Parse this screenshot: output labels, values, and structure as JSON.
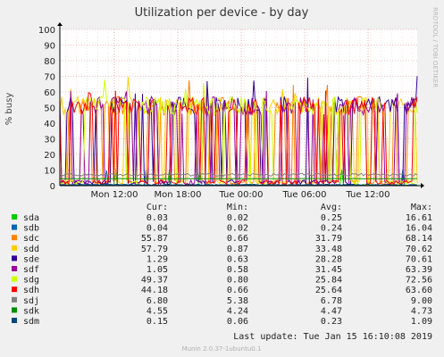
{
  "chart_data": {
    "type": "line",
    "title": "Utilization per device - by day",
    "ylabel": "% busy",
    "ylim": [
      0,
      100
    ],
    "y_ticks": [
      0,
      10,
      20,
      30,
      40,
      50,
      60,
      70,
      80,
      90,
      100
    ],
    "x_ticks": [
      "Mon 12:00",
      "Mon 18:00",
      "Tue 00:00",
      "Tue 06:00",
      "Tue 12:00"
    ],
    "grid": true,
    "watermark": "RRDTOOL / TOBI OETIKER",
    "legend_headers": {
      "cur": "Cur:",
      "min": "Min:",
      "avg": "Avg:",
      "max": "Max:"
    },
    "series": [
      {
        "name": "sda",
        "color": "#00cc00",
        "cur": "0.03",
        "min": "0.02",
        "avg": "0.25",
        "max": "16.61"
      },
      {
        "name": "sdb",
        "color": "#0066b3",
        "cur": "0.04",
        "min": "0.02",
        "avg": "0.24",
        "max": "16.04"
      },
      {
        "name": "sdc",
        "color": "#ff8000",
        "cur": "55.87",
        "min": "0.66",
        "avg": "31.79",
        "max": "68.14"
      },
      {
        "name": "sdd",
        "color": "#ffcc00",
        "cur": "57.79",
        "min": "0.87",
        "avg": "33.48",
        "max": "70.62"
      },
      {
        "name": "sde",
        "color": "#330099",
        "cur": "1.29",
        "min": "0.63",
        "avg": "28.28",
        "max": "70.61"
      },
      {
        "name": "sdf",
        "color": "#990099",
        "cur": "1.05",
        "min": "0.58",
        "avg": "31.45",
        "max": "63.39"
      },
      {
        "name": "sdg",
        "color": "#ccff00",
        "cur": "49.37",
        "min": "0.80",
        "avg": "25.84",
        "max": "72.56"
      },
      {
        "name": "sdh",
        "color": "#ff0000",
        "cur": "44.18",
        "min": "0.66",
        "avg": "25.64",
        "max": "63.60"
      },
      {
        "name": "sdj",
        "color": "#808080",
        "cur": "6.80",
        "min": "5.38",
        "avg": "6.78",
        "max": "9.00"
      },
      {
        "name": "sdk",
        "color": "#008f00",
        "cur": "4.55",
        "min": "4.24",
        "avg": "4.47",
        "max": "4.73"
      },
      {
        "name": "sdm",
        "color": "#00487d",
        "cur": "0.15",
        "min": "0.06",
        "avg": "0.23",
        "max": "1.09"
      }
    ],
    "last_update": "Last update: Tue Jan 15 16:10:08 2019",
    "footer": "Munin 2.0.37-1ubuntu0.1"
  }
}
